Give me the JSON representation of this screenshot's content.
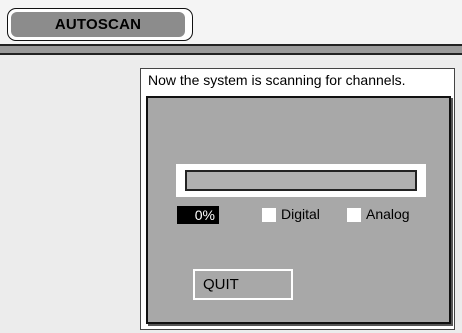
{
  "header": {
    "title": "AUTOSCAN"
  },
  "dialog": {
    "message": "Now the system is scanning for channels.",
    "progress_value": 0,
    "progress_text": "0%",
    "options": [
      {
        "label": "Digital",
        "checked": false
      },
      {
        "label": "Analog",
        "checked": false
      }
    ],
    "quit_label": "QUIT"
  },
  "colors": {
    "page_background": "#ececec",
    "header_tab_fill": "#8c8c8c",
    "panel_fill": "#a8a8a8",
    "percent_box": "#000000"
  }
}
